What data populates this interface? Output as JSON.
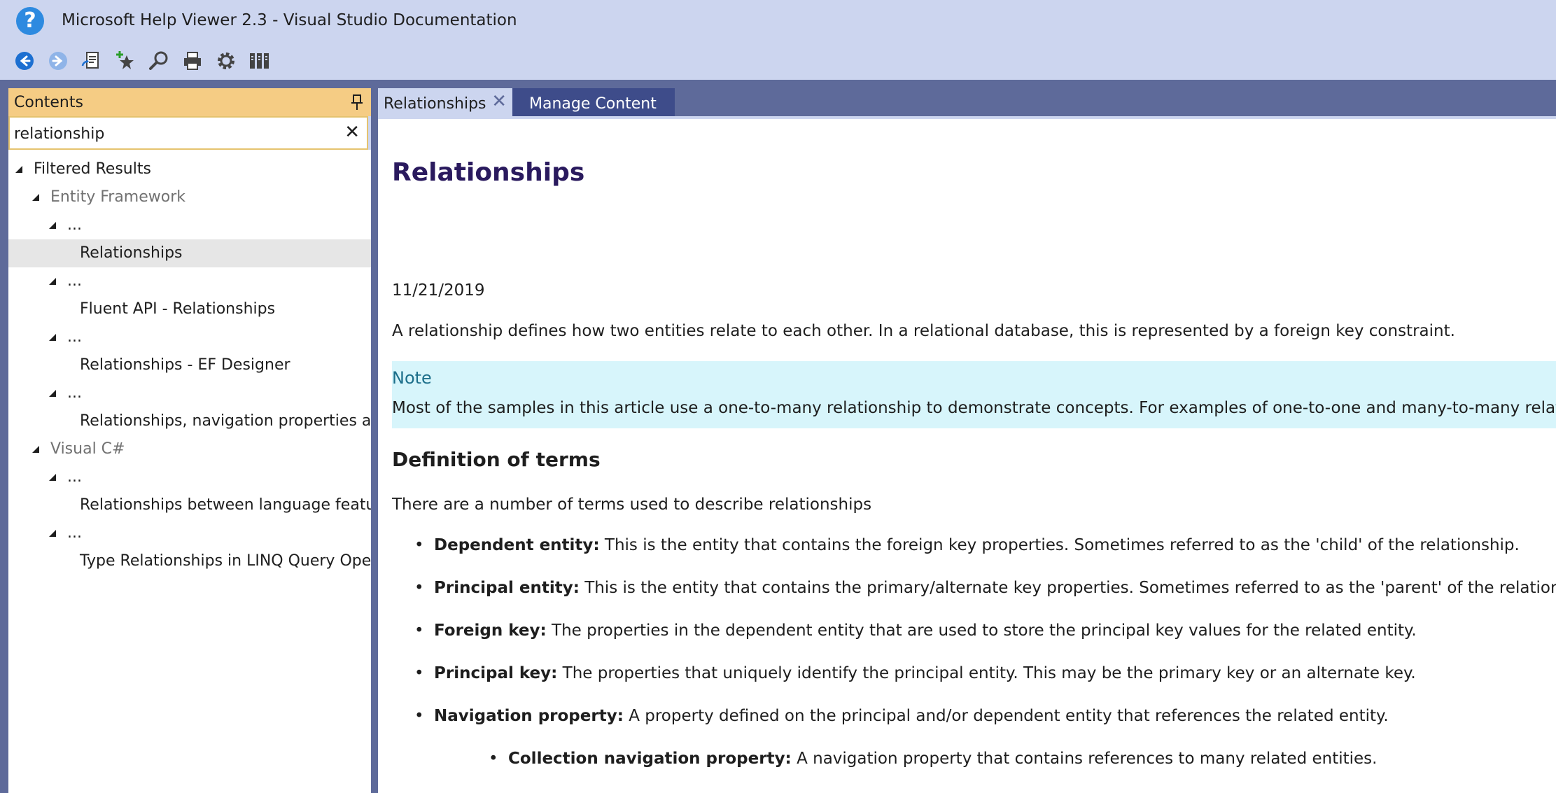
{
  "window": {
    "title": "Microsoft Help Viewer 2.3 - Visual Studio Documentation",
    "icon": "help-question-icon"
  },
  "toolbar": {
    "buttons": [
      {
        "name": "back",
        "icon": "back-arrow-icon",
        "color": "#1c6fd1"
      },
      {
        "name": "forward",
        "icon": "forward-arrow-icon",
        "color": "#8fb4e8"
      },
      {
        "name": "sync-toc",
        "icon": "sync-contents-icon"
      },
      {
        "name": "add-favorite",
        "icon": "add-favorite-icon"
      },
      {
        "name": "find",
        "icon": "find-magnifier-icon"
      },
      {
        "name": "print",
        "icon": "printer-icon"
      },
      {
        "name": "settings",
        "icon": "gear-icon"
      },
      {
        "name": "manage-content",
        "icon": "library-books-icon"
      }
    ]
  },
  "contents": {
    "title": "Contents",
    "pin_icon": "pin-icon",
    "search": {
      "value": "relationship",
      "clear": "✕"
    },
    "tree": [
      {
        "label": "Filtered Results",
        "level": 0,
        "expanded": true
      },
      {
        "label": "Entity Framework",
        "level": 1,
        "expanded": true,
        "muted": true
      },
      {
        "label": "...",
        "level": 2,
        "expanded": true
      },
      {
        "label": "Relationships",
        "level": 3,
        "selected": true
      },
      {
        "label": "...",
        "level": 2,
        "expanded": true
      },
      {
        "label": "Fluent API - Relationships",
        "level": 3
      },
      {
        "label": "...",
        "level": 2,
        "expanded": true
      },
      {
        "label": "Relationships - EF Designer",
        "level": 3
      },
      {
        "label": "...",
        "level": 2,
        "expanded": true
      },
      {
        "label": "Relationships, navigation properties and foreign keys",
        "level": 3
      },
      {
        "label": "Visual C#",
        "level": 1,
        "expanded": true,
        "muted": true
      },
      {
        "label": "...",
        "level": 2,
        "expanded": true
      },
      {
        "label": "Relationships between language features",
        "level": 3
      },
      {
        "label": "...",
        "level": 2,
        "expanded": true
      },
      {
        "label": "Type Relationships in LINQ Query Operations",
        "level": 3
      }
    ]
  },
  "tabs": {
    "active": {
      "label": "Relationships",
      "close": "✕"
    },
    "inactive": {
      "label": "Manage Content"
    }
  },
  "document": {
    "title": "Relationships",
    "date": "11/21/2019",
    "intro": "A relationship defines how two entities relate to each other. In a relational database, this is represented by a foreign key constraint.",
    "note": {
      "title": "Note",
      "text": "Most of the samples in this article use a one-to-many relationship to demonstrate concepts. For examples of one-to-one and many-to-many relationships see"
    },
    "section_heading": "Definition of terms",
    "section_intro": "There are a number of terms used to describe relationships",
    "terms": [
      {
        "term": "Dependent entity:",
        "desc": " This is the entity that contains the foreign key properties. Sometimes referred to as the 'child' of the relationship."
      },
      {
        "term": "Principal entity:",
        "desc": " This is the entity that contains the primary/alternate key properties. Sometimes referred to as the 'parent' of the relationship."
      },
      {
        "term": "Foreign key:",
        "desc": " The properties in the dependent entity that are used to store the principal key values for the related entity."
      },
      {
        "term": "Principal key:",
        "desc": " The properties that uniquely identify the principal entity. This may be the primary key or an alternate key."
      },
      {
        "term": "Navigation property:",
        "desc": " A property defined on the principal and/or dependent entity that references the related entity."
      }
    ],
    "sub_terms": [
      {
        "term": "Collection navigation property:",
        "desc": " A navigation property that contains references to many related entities."
      }
    ]
  },
  "colors": {
    "chrome": "#ccd5ef",
    "accent": "#5e6a9a",
    "contents_header": "#f5cc84",
    "note_background": "#d7f5fb",
    "note_title": "#1d6f8b",
    "doc_title": "#2a1a5e"
  }
}
